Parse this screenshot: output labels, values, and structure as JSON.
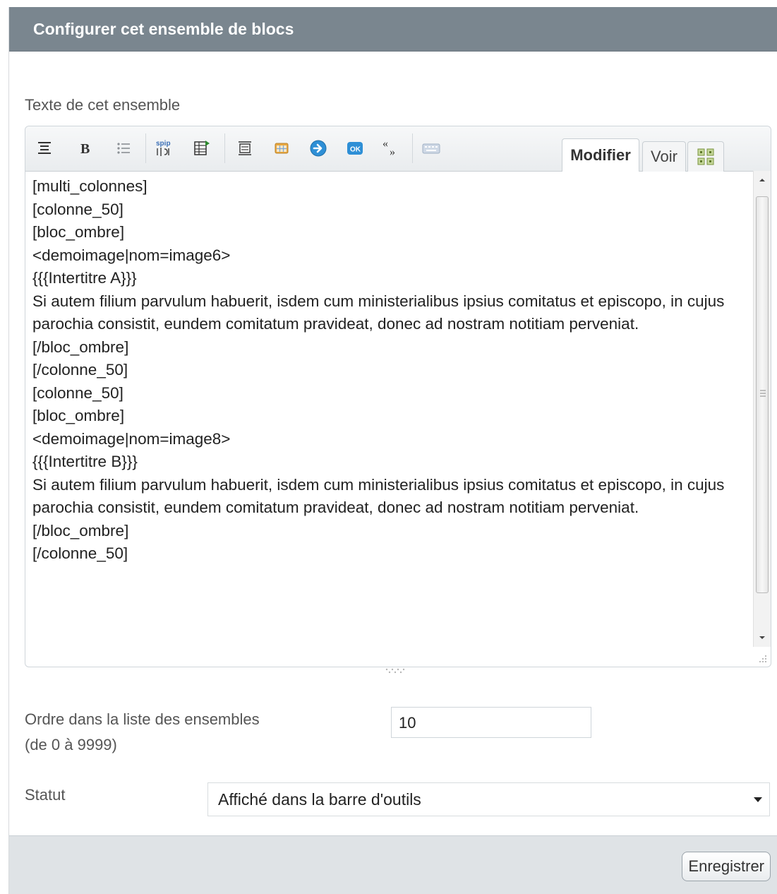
{
  "header": {
    "title": "Configurer cet ensemble de blocs"
  },
  "texte": {
    "label": "Texte de cet ensemble",
    "tabs": {
      "modifier": "Modifier",
      "voir": "Voir"
    },
    "content": "[multi_colonnes]\n[colonne_50]\n[bloc_ombre]\n<demoimage|nom=image6>\n{{{Intertitre A}}}\nSi autem filium parvulum habuerit, isdem cum ministerialibus ipsius comitatus et episcopo, in cujus parochia consistit, eundem comitatum pravideat, donec ad nostram notitiam perveniat.\n[/bloc_ombre]\n[/colonne_50]\n[colonne_50]\n[bloc_ombre]\n<demoimage|nom=image8>\n{{{Intertitre B}}}\nSi autem filium parvulum habuerit, isdem cum ministerialibus ipsius comitatus et episcopo, in cujus parochia consistit, eundem comitatum pravideat, donec ad nostram notitiam perveniat.\n[/bloc_ombre]\n[/colonne_50]"
  },
  "ordre": {
    "label_line1": "Ordre dans la liste des ensembles",
    "label_line2": "(de 0 à 9999)",
    "value": "10"
  },
  "statut": {
    "label": "Statut",
    "selected": "Affiché dans la barre d'outils"
  },
  "footer": {
    "save_label": "Enregistrer"
  },
  "toolbar_icons": [
    "align-center-icon",
    "bold-icon",
    "bullet-list-icon",
    "spip-icon",
    "table-icon",
    "block-icon",
    "grid-icon",
    "arrow-right-icon",
    "ok-icon",
    "quote-icon",
    "keyboard-icon",
    "fullscreen-icon"
  ]
}
